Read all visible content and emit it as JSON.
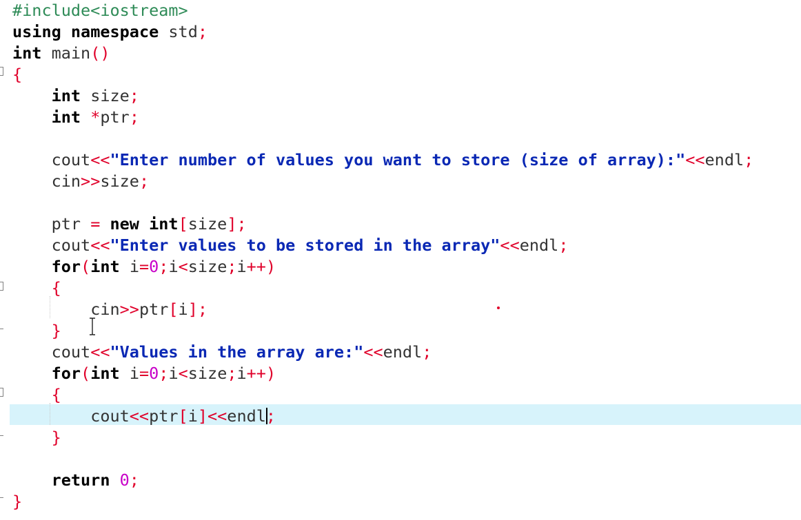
{
  "editor": {
    "language": "C++",
    "code_lines": [
      "#include<iostream>",
      "using namespace std;",
      "int main()",
      "{",
      "    int size;",
      "    int *ptr;",
      "",
      "    cout<<\"Enter number of values you want to store (size of array):\"<<endl;",
      "    cin>>size;",
      "",
      "    ptr = new int[size];",
      "    cout<<\"Enter values to be stored in the array\"<<endl;",
      "    for(int i=0;i<size;i++)",
      "    {",
      "        cin>>ptr[i];",
      "    }",
      "    cout<<\"Values in the array are:\"<<endl;",
      "    for(int i=0;i<size;i++)",
      "    {",
      "        cout<<ptr[i]<<endl;",
      "    }",
      "",
      "    return 0;",
      "}"
    ],
    "current_line_number": 20,
    "colors": {
      "keyword": "#000000",
      "preprocessor": "#2e8b57",
      "operator": "#e0002a",
      "string": "#0a28b4",
      "number": "#c800c8",
      "identifier": "#333333",
      "current_line_highlight": "#d7f3fb",
      "background": "#ffffff"
    },
    "icons": {
      "fold_marker": "fold-box-icon",
      "mouse_cursor": "i-beam-cursor-icon"
    }
  }
}
